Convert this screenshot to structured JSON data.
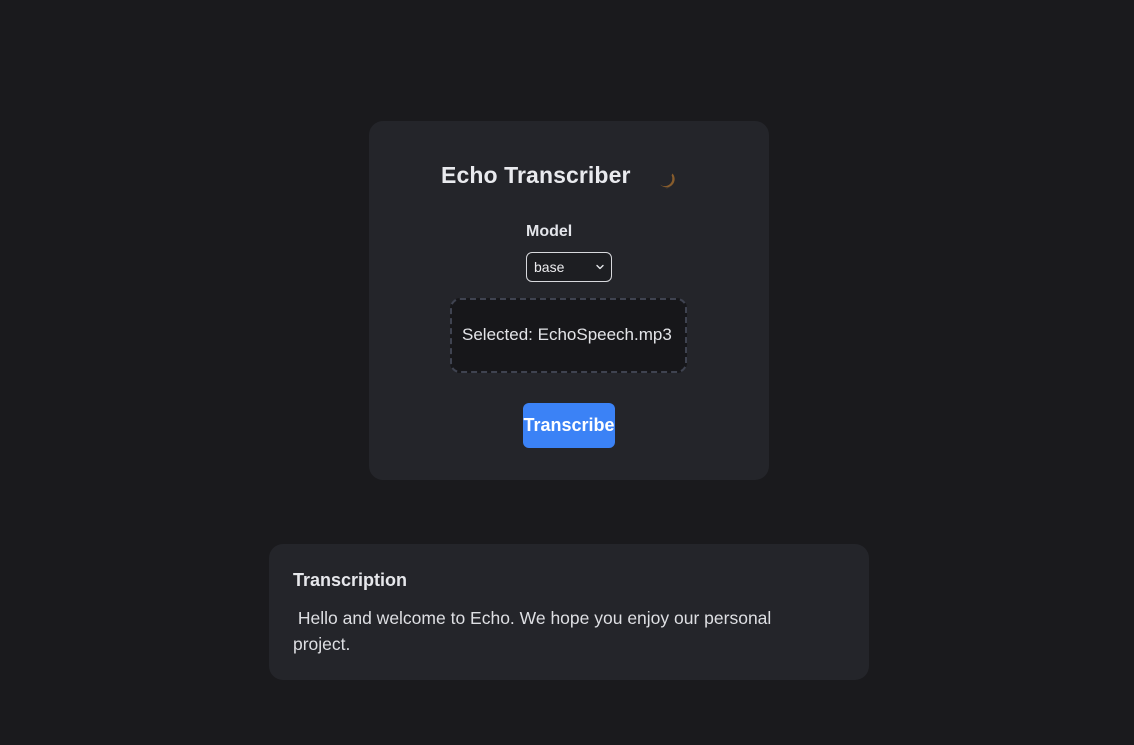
{
  "app": {
    "title": "Echo Transcriber",
    "theme_icon": "crescent-moon-icon"
  },
  "model": {
    "label": "Model",
    "selected": "base"
  },
  "upload": {
    "status_text": "Selected: EchoSpeech.mp3"
  },
  "actions": {
    "transcribe_label": "Transcribe"
  },
  "transcription": {
    "heading": "Transcription",
    "text": " Hello and welcome to Echo. We hope you enjoy our personal project."
  },
  "colors": {
    "background": "#1a1a1d",
    "card": "#24252a",
    "accent": "#3b82f6",
    "moon": "#f6b860"
  }
}
